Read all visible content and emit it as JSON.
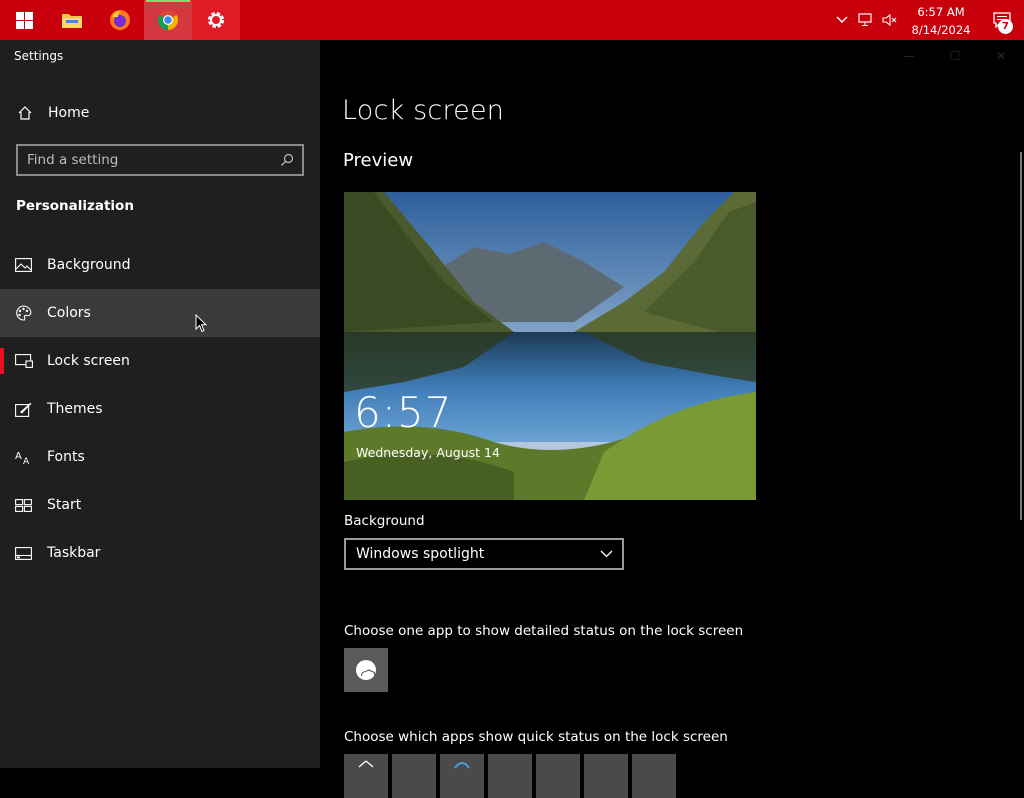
{
  "taskbar": {
    "apps": [
      {
        "name": "Start",
        "icon": "windows-logo-icon"
      },
      {
        "name": "File Explorer",
        "icon": "folder-icon"
      },
      {
        "name": "Firefox",
        "icon": "firefox-icon"
      },
      {
        "name": "Chrome",
        "icon": "chrome-icon"
      },
      {
        "name": "Settings",
        "icon": "gear-icon"
      }
    ],
    "tray": {
      "time": "6:57 AM",
      "date": "8/14/2024",
      "notification_count": "7"
    },
    "accent_color": "#c8000c"
  },
  "window": {
    "app_title": "Settings"
  },
  "sidebar": {
    "home_label": "Home",
    "search_placeholder": "Find a setting",
    "section_title": "Personalization",
    "items": [
      {
        "label": "Background",
        "icon": "picture-icon"
      },
      {
        "label": "Colors",
        "icon": "palette-icon"
      },
      {
        "label": "Lock screen",
        "icon": "lock-screen-icon"
      },
      {
        "label": "Themes",
        "icon": "themes-icon"
      },
      {
        "label": "Fonts",
        "icon": "fonts-icon"
      },
      {
        "label": "Start",
        "icon": "start-icon"
      },
      {
        "label": "Taskbar",
        "icon": "taskbar-icon"
      }
    ],
    "hovered_item": "Colors",
    "selected_item": "Lock screen"
  },
  "main": {
    "title": "Lock screen",
    "preview_heading": "Preview",
    "preview_time": "6:57",
    "preview_date": "Wednesday, August 14",
    "background_label": "Background",
    "background_value": "Windows spotlight",
    "detailed_status_label": "Choose one app to show detailed status on the lock screen",
    "quick_status_label": "Choose which apps show quick status on the lock screen"
  }
}
